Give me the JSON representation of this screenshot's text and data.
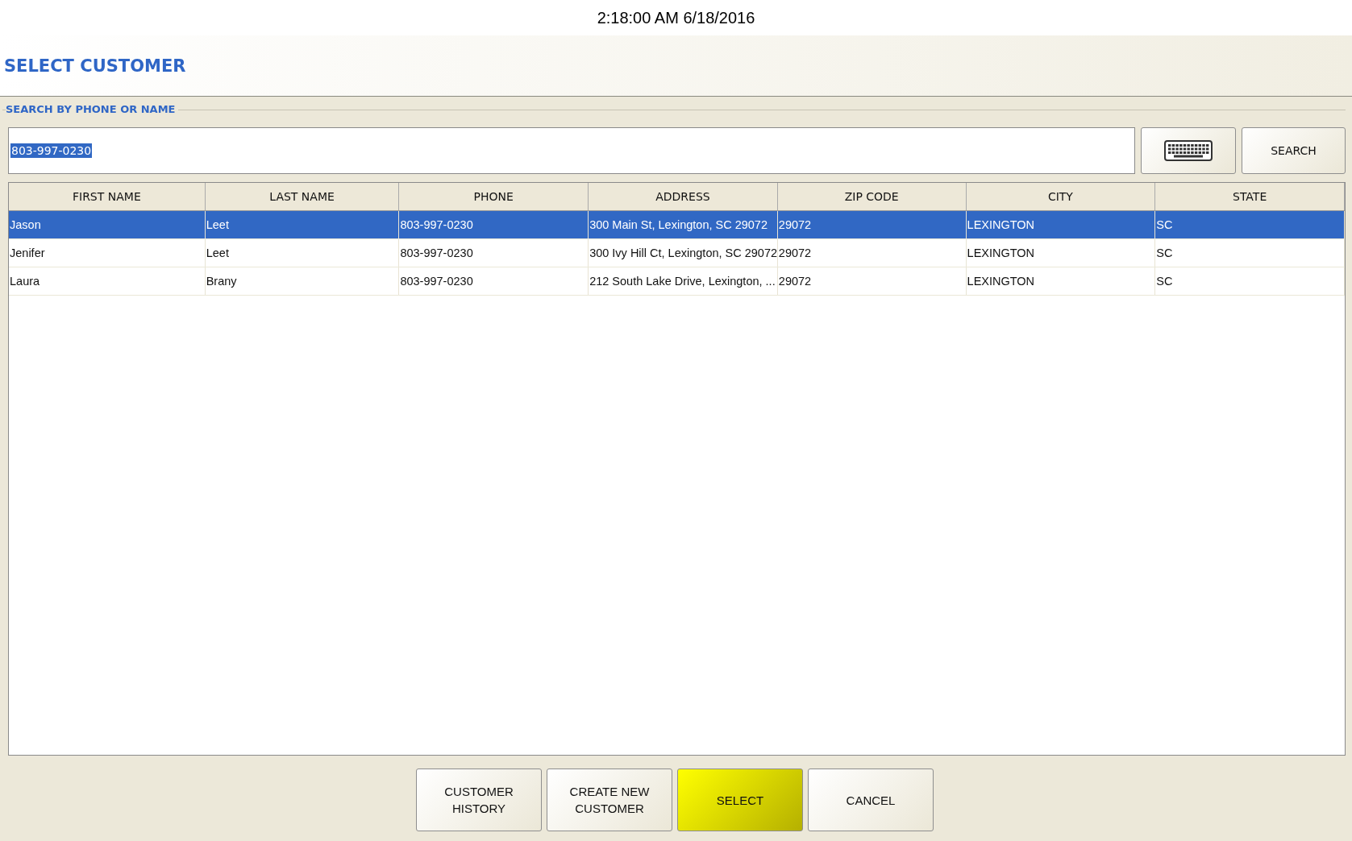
{
  "clock": "2:18:00 AM 6/18/2016",
  "title": "SELECT CUSTOMER",
  "search": {
    "label": "SEARCH BY PHONE OR NAME",
    "value": "803-997-0230",
    "value_highlighted": true,
    "button": "SEARCH"
  },
  "table": {
    "columns": [
      "FIRST NAME",
      "LAST NAME",
      "PHONE",
      "ADDRESS",
      "ZIP CODE",
      "CITY",
      "STATE"
    ],
    "rows": [
      {
        "selected": true,
        "cells": [
          "Jason",
          "Leet",
          "803-997-0230",
          "300 Main St, Lexington, SC 29072",
          "29072",
          "LEXINGTON",
          "SC"
        ]
      },
      {
        "selected": false,
        "cells": [
          "Jenifer",
          "Leet",
          "803-997-0230",
          "300 Ivy Hill Ct, Lexington, SC 29072",
          "29072",
          "LEXINGTON",
          "SC"
        ]
      },
      {
        "selected": false,
        "cells": [
          "Laura",
          "Brany",
          "803-997-0230",
          "212 South Lake Drive, Lexington, ...",
          "29072",
          "LEXINGTON",
          "SC"
        ]
      }
    ]
  },
  "buttons": [
    {
      "label": "CUSTOMER HISTORY",
      "kind": "normal"
    },
    {
      "label": "CREATE NEW CUSTOMER",
      "kind": "normal"
    },
    {
      "label": "SELECT",
      "kind": "primary"
    },
    {
      "label": "CANCEL",
      "kind": "normal"
    }
  ]
}
